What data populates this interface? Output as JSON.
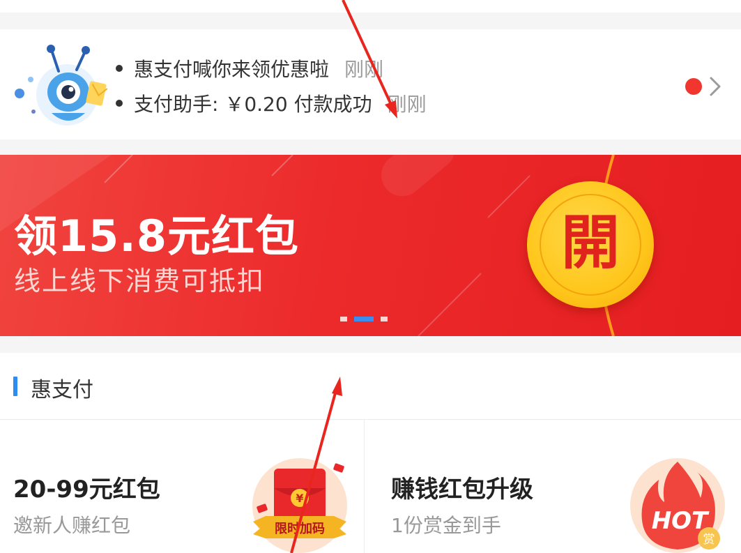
{
  "notices": [
    {
      "text": "惠支付喊你来领优惠啦",
      "time": "刚刚"
    },
    {
      "text": "支付助手: ￥0.20 付款成功",
      "time": "刚刚"
    }
  ],
  "banner": {
    "title": "领15.8元红包",
    "subtitle": "线上线下消费可抵扣",
    "open_label": "開",
    "page_count": 3,
    "active_page": 2
  },
  "section": {
    "title": "惠支付",
    "items": [
      {
        "title": "20-99元红包",
        "subtitle": "邀新人赚红包",
        "icon": "red-envelope-icon",
        "ribbon": "限时加码",
        "symbol": "¥"
      },
      {
        "title": "赚钱红包升级",
        "subtitle": "1份赏金到手",
        "icon": "hot-flame-icon",
        "badge": "HOT",
        "corner": "赏"
      }
    ]
  },
  "colors": {
    "banner_red": "#e51e21",
    "accent_blue": "#2d8cf0",
    "coin_gold": "#ffc61a",
    "unread_dot": "#f0362f"
  }
}
